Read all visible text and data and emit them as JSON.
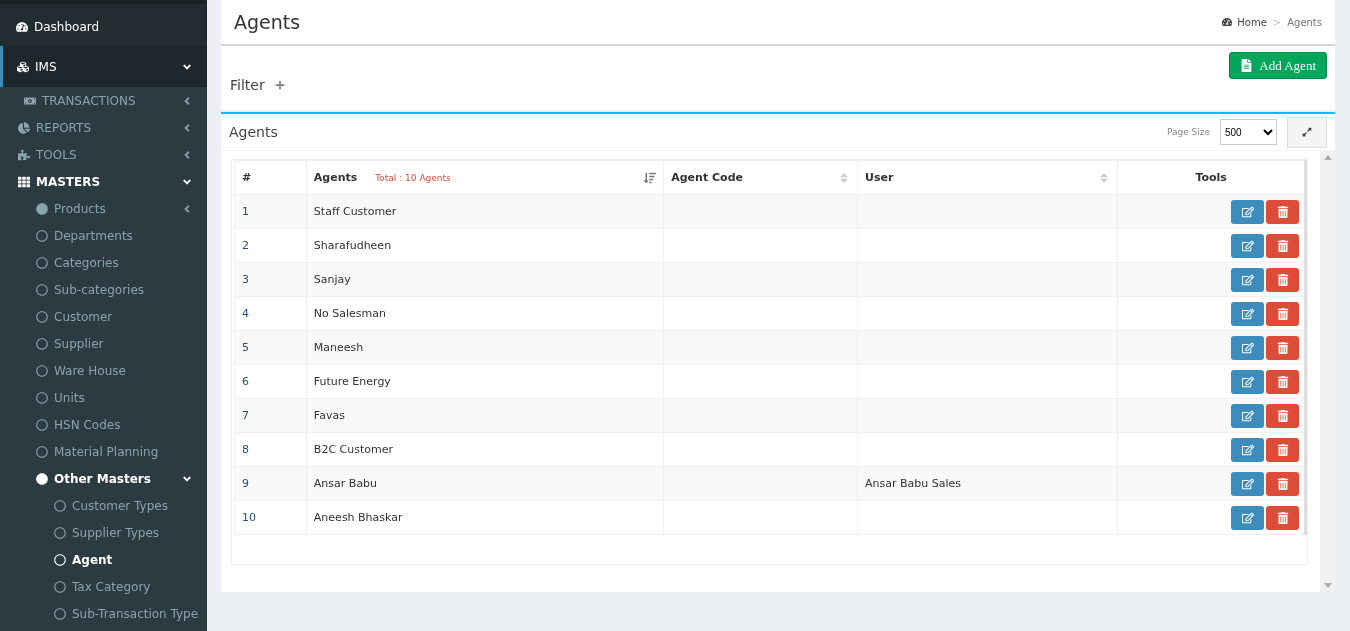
{
  "sidebar": {
    "items": [
      {
        "label": "Dashboard",
        "kind": "top",
        "active": false
      },
      {
        "label": "IMS",
        "kind": "top",
        "active": true,
        "expanded": true,
        "children": [
          {
            "label": "TRANSACTIONS",
            "kind": "section",
            "active": false,
            "expanded": false
          },
          {
            "label": "REPORTS",
            "kind": "section",
            "active": false,
            "expanded": false
          },
          {
            "label": "TOOLS",
            "kind": "section",
            "active": false,
            "expanded": false
          },
          {
            "label": "MASTERS",
            "kind": "section",
            "active": true,
            "expanded": true,
            "children": [
              {
                "label": "Products",
                "kind": "group",
                "active": false,
                "expanded": false
              },
              {
                "label": "Departments",
                "kind": "leaf",
                "selected": false
              },
              {
                "label": "Categories",
                "kind": "leaf",
                "selected": false
              },
              {
                "label": "Sub-categories",
                "kind": "leaf",
                "selected": false
              },
              {
                "label": "Customer",
                "kind": "leaf",
                "selected": false
              },
              {
                "label": "Supplier",
                "kind": "leaf",
                "selected": false
              },
              {
                "label": "Ware House",
                "kind": "leaf",
                "selected": false
              },
              {
                "label": "Units",
                "kind": "leaf",
                "selected": false
              },
              {
                "label": "HSN Codes",
                "kind": "leaf",
                "selected": false
              },
              {
                "label": "Material Planning",
                "kind": "leaf",
                "selected": false
              },
              {
                "label": "Other Masters",
                "kind": "group",
                "active": true,
                "expanded": true,
                "children": [
                  {
                    "label": "Customer Types",
                    "kind": "leaf",
                    "selected": false
                  },
                  {
                    "label": "Supplier Types",
                    "kind": "leaf",
                    "selected": false
                  },
                  {
                    "label": "Agent",
                    "kind": "leaf",
                    "selected": true
                  },
                  {
                    "label": "Tax Category",
                    "kind": "leaf",
                    "selected": false
                  },
                  {
                    "label": "Sub-Transaction Type",
                    "kind": "leaf",
                    "selected": false
                  }
                ]
              }
            ]
          }
        ]
      }
    ]
  },
  "page": {
    "title": "Agents",
    "breadcrumb": [
      "Home",
      "Agents"
    ],
    "breadcrumb_separator": ">"
  },
  "filter": {
    "title": "Filter",
    "add_button": "Add Agent"
  },
  "table_box": {
    "title": "Agents",
    "page_size_label": "Page Size",
    "page_size": "500"
  },
  "table": {
    "columns": [
      {
        "label": "#"
      },
      {
        "label": "Agents",
        "note": "Total : 10 Agents",
        "sorted": true
      },
      {
        "label": "Agent Code",
        "sorted": false
      },
      {
        "label": "User",
        "sorted": false
      },
      {
        "label": "Tools"
      }
    ],
    "rows": [
      {
        "number": "1",
        "agent": "Staff Customer"
      },
      {
        "number": "2",
        "agent": "Sharafudheen"
      },
      {
        "number": "3",
        "agent": "Sanjay"
      },
      {
        "number": "4",
        "agent": "No Salesman"
      },
      {
        "number": "5",
        "agent": "Maneesh"
      },
      {
        "number": "6",
        "agent": "Future Energy"
      },
      {
        "number": "7",
        "agent": "Favas"
      },
      {
        "number": "8",
        "agent": "B2C Customer"
      },
      {
        "number": "9",
        "agent": "Ansar Babu",
        "user": "Ansar Babu Sales"
      },
      {
        "number": "10",
        "agent": "Aneesh Bhaskar"
      }
    ]
  }
}
